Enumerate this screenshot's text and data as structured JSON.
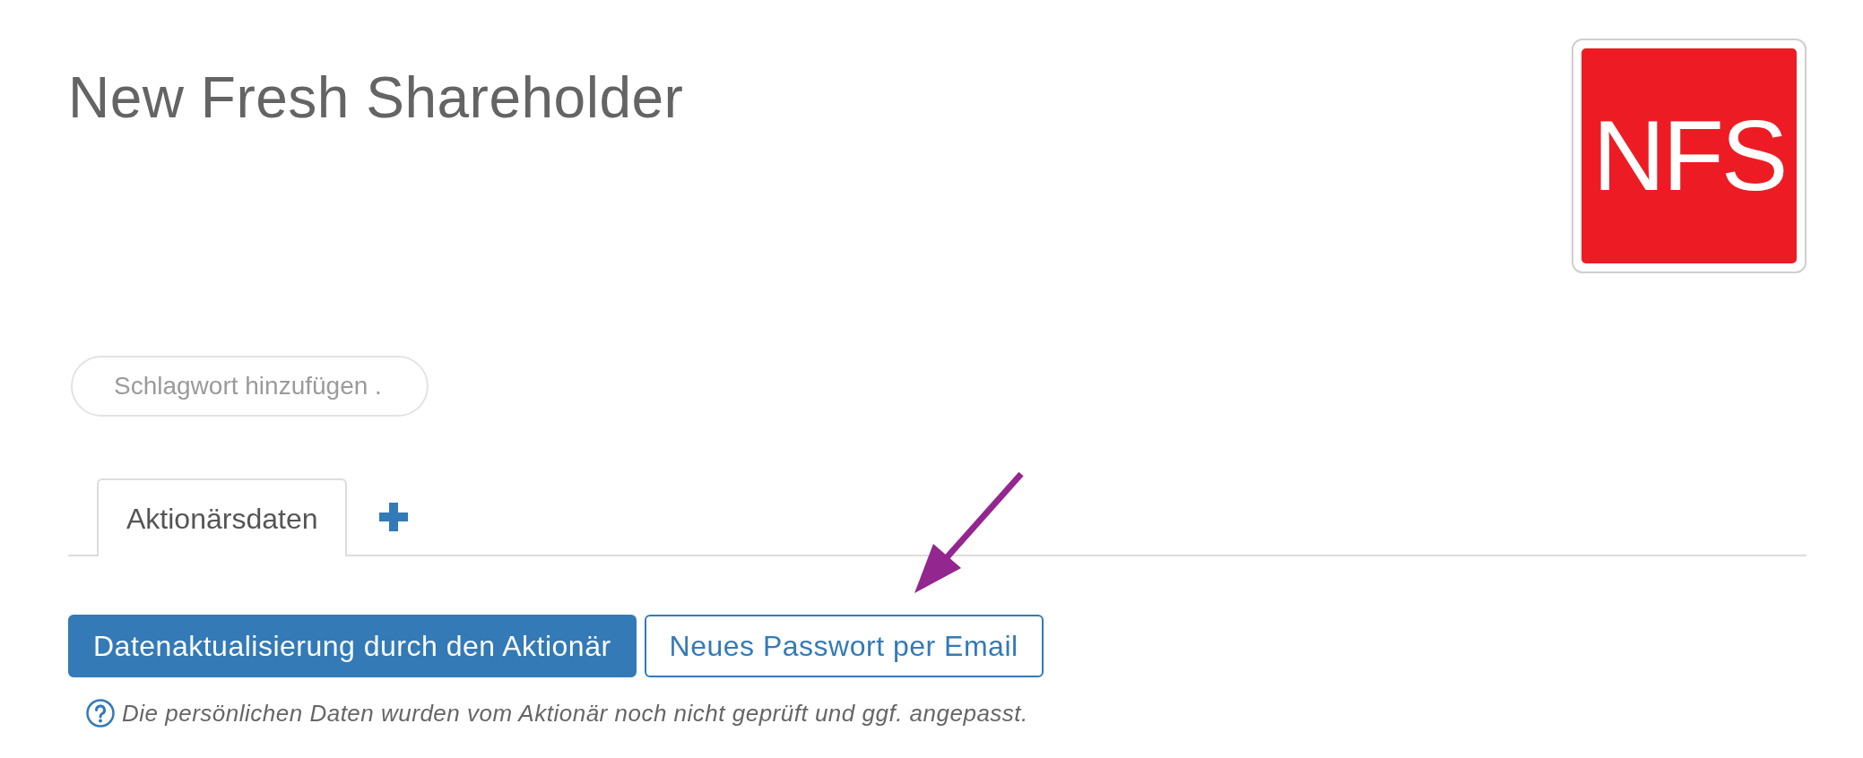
{
  "header": {
    "title": "New Fresh Shareholder",
    "logo": {
      "text": "NFS"
    }
  },
  "tag_field": {
    "placeholder": "Schlagwort hinzufügen ."
  },
  "tabs": [
    {
      "label": "Aktionärsdaten",
      "selected": true
    }
  ],
  "actions": [
    {
      "label": "Datenaktualisierung durch den Aktionär",
      "kind": "primary"
    },
    {
      "label": "Neues Passwort per Email",
      "kind": "outline"
    }
  ],
  "hint": {
    "text": "Die persönlichen Daten wurden vom Aktionär noch nicht geprüft und ggf. angepasst."
  }
}
